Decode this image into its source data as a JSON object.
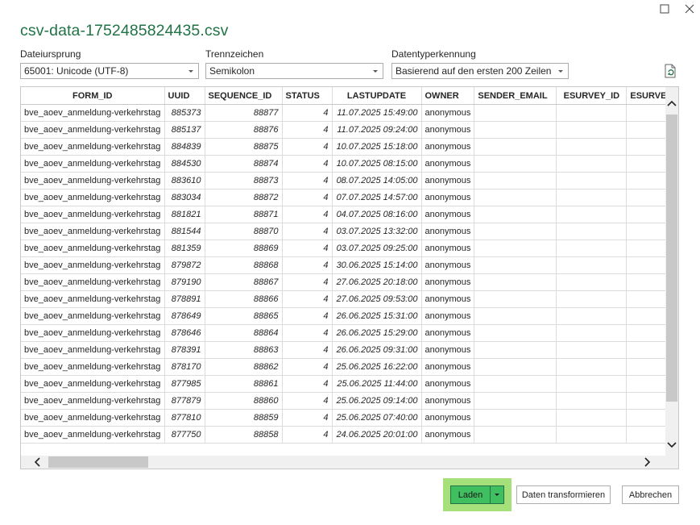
{
  "window": {
    "maximize_icon": "maximize-icon",
    "close_icon": "close-icon"
  },
  "title": "csv-data-1752485824435.csv",
  "options": {
    "file_origin": {
      "label": "Dateiursprung",
      "value": "65001: Unicode (UTF-8)"
    },
    "delimiter": {
      "label": "Trennzeichen",
      "value": "Semikolon"
    },
    "type_detection": {
      "label": "Datentyperkennung",
      "value": "Basierend auf den ersten 200 Zeilen"
    },
    "refresh_icon": "refresh-file-icon"
  },
  "table": {
    "columns": [
      "FORM_ID",
      "UUID",
      "SEQUENCE_ID",
      "STATUS",
      "LASTUPDATE",
      "OWNER",
      "SENDER_EMAIL",
      "ESURVEY_ID",
      "ESURVEY"
    ],
    "rows": [
      [
        "bve_aoev_anmeldung-verkehrstag",
        "885373",
        "88877",
        "4",
        "11.07.2025 15:49:00",
        "anonymous",
        "",
        "",
        ""
      ],
      [
        "bve_aoev_anmeldung-verkehrstag",
        "885137",
        "88876",
        "4",
        "11.07.2025 09:24:00",
        "anonymous",
        "",
        "",
        ""
      ],
      [
        "bve_aoev_anmeldung-verkehrstag",
        "884839",
        "88875",
        "4",
        "10.07.2025 15:18:00",
        "anonymous",
        "",
        "",
        ""
      ],
      [
        "bve_aoev_anmeldung-verkehrstag",
        "884530",
        "88874",
        "4",
        "10.07.2025 08:15:00",
        "anonymous",
        "",
        "",
        ""
      ],
      [
        "bve_aoev_anmeldung-verkehrstag",
        "883610",
        "88873",
        "4",
        "08.07.2025 14:05:00",
        "anonymous",
        "",
        "",
        ""
      ],
      [
        "bve_aoev_anmeldung-verkehrstag",
        "883034",
        "88872",
        "4",
        "07.07.2025 14:57:00",
        "anonymous",
        "",
        "",
        ""
      ],
      [
        "bve_aoev_anmeldung-verkehrstag",
        "881821",
        "88871",
        "4",
        "04.07.2025 08:16:00",
        "anonymous",
        "",
        "",
        ""
      ],
      [
        "bve_aoev_anmeldung-verkehrstag",
        "881544",
        "88870",
        "4",
        "03.07.2025 13:32:00",
        "anonymous",
        "",
        "",
        ""
      ],
      [
        "bve_aoev_anmeldung-verkehrstag",
        "881359",
        "88869",
        "4",
        "03.07.2025 09:25:00",
        "anonymous",
        "",
        "",
        ""
      ],
      [
        "bve_aoev_anmeldung-verkehrstag",
        "879872",
        "88868",
        "4",
        "30.06.2025 15:14:00",
        "anonymous",
        "",
        "",
        ""
      ],
      [
        "bve_aoev_anmeldung-verkehrstag",
        "879190",
        "88867",
        "4",
        "27.06.2025 20:18:00",
        "anonymous",
        "",
        "",
        ""
      ],
      [
        "bve_aoev_anmeldung-verkehrstag",
        "878891",
        "88866",
        "4",
        "27.06.2025 09:53:00",
        "anonymous",
        "",
        "",
        ""
      ],
      [
        "bve_aoev_anmeldung-verkehrstag",
        "878649",
        "88865",
        "4",
        "26.06.2025 15:31:00",
        "anonymous",
        "",
        "",
        ""
      ],
      [
        "bve_aoev_anmeldung-verkehrstag",
        "878646",
        "88864",
        "4",
        "26.06.2025 15:29:00",
        "anonymous",
        "",
        "",
        ""
      ],
      [
        "bve_aoev_anmeldung-verkehrstag",
        "878391",
        "88863",
        "4",
        "26.06.2025 09:31:00",
        "anonymous",
        "",
        "",
        ""
      ],
      [
        "bve_aoev_anmeldung-verkehrstag",
        "878170",
        "88862",
        "4",
        "25.06.2025 16:22:00",
        "anonymous",
        "",
        "",
        ""
      ],
      [
        "bve_aoev_anmeldung-verkehrstag",
        "877985",
        "88861",
        "4",
        "25.06.2025 11:44:00",
        "anonymous",
        "",
        "",
        ""
      ],
      [
        "bve_aoev_anmeldung-verkehrstag",
        "877879",
        "88860",
        "4",
        "25.06.2025 09:14:00",
        "anonymous",
        "",
        "",
        ""
      ],
      [
        "bve_aoev_anmeldung-verkehrstag",
        "877810",
        "88859",
        "4",
        "25.06.2025 07:40:00",
        "anonymous",
        "",
        "",
        ""
      ],
      [
        "bve_aoev_anmeldung-verkehrstag",
        "877750",
        "88858",
        "4",
        "24.06.2025 20:01:00",
        "anonymous",
        "",
        "",
        ""
      ]
    ]
  },
  "buttons": {
    "load": "Laden",
    "transform": "Daten transformieren",
    "cancel": "Abbrechen"
  },
  "colors": {
    "accent": "#217346",
    "load_highlight": "#a6e07a",
    "load_button": "#3fbf5f"
  }
}
